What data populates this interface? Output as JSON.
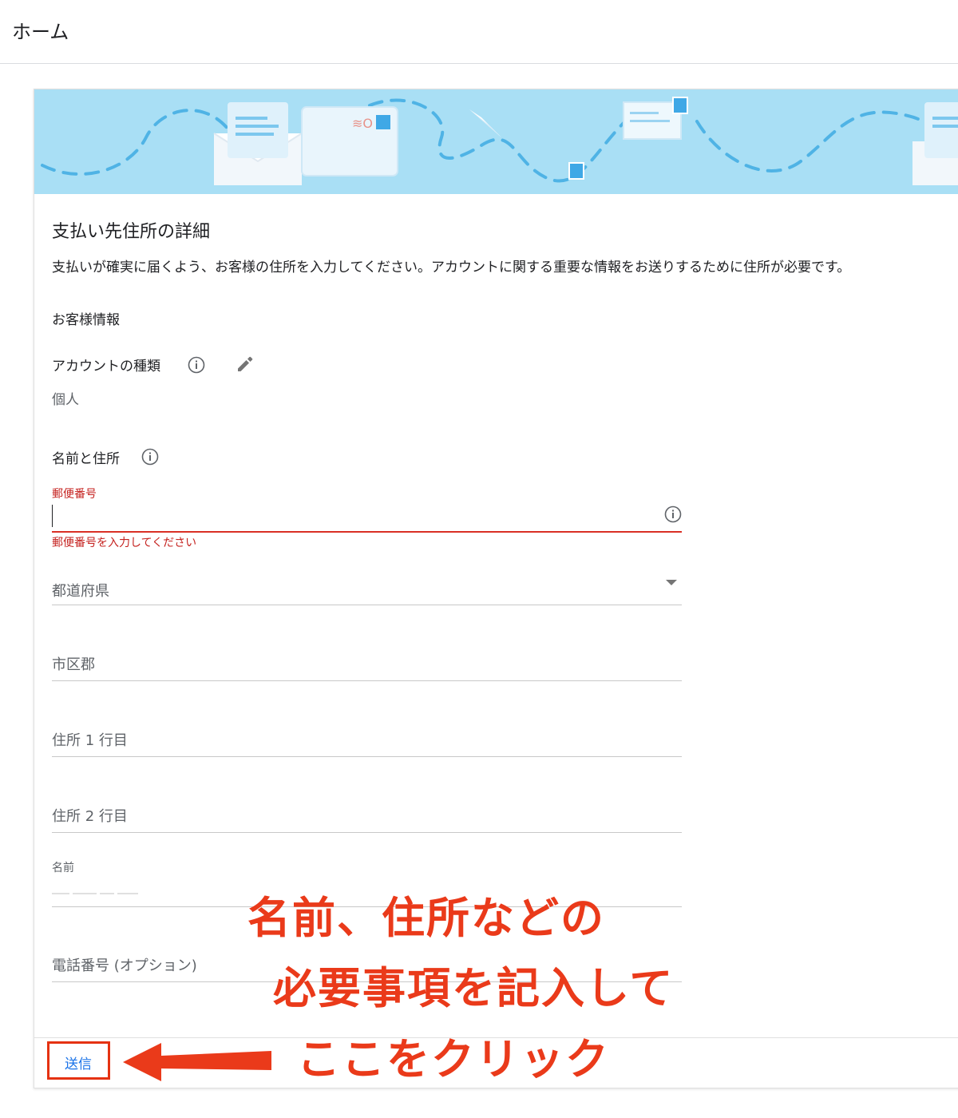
{
  "topbar": {
    "title": "ホーム"
  },
  "banner": {},
  "form": {
    "heading": "支払い先住所の詳細",
    "description": "支払いが確実に届くよう、お客様の住所を入力してください。アカウントに関する重要な情報をお送りするために住所が必要です。",
    "customer_section": "お客様情報",
    "account_type_label": "アカウントの種類",
    "account_type_value": "個人",
    "name_address_label": "名前と住所",
    "postal_code": {
      "label": "郵便番号",
      "value": "",
      "error": "郵便番号を入力してください"
    },
    "prefecture": {
      "placeholder": "都道府県"
    },
    "city": {
      "placeholder": "市区郡"
    },
    "address1": {
      "placeholder": "住所 1 行目"
    },
    "address2": {
      "placeholder": "住所 2 行目"
    },
    "name": {
      "label": "名前"
    },
    "phone": {
      "placeholder": "電話番号 (オプション)"
    },
    "submit_label": "送信"
  },
  "annotation": {
    "line1": "名前、住所などの",
    "line2": "必要事項を記入して",
    "line3": "ここをクリック",
    "color": "#ea3a1a"
  },
  "colors": {
    "accent": "#1a73e8",
    "error": "#d93025",
    "banner": "#a9dff5"
  }
}
